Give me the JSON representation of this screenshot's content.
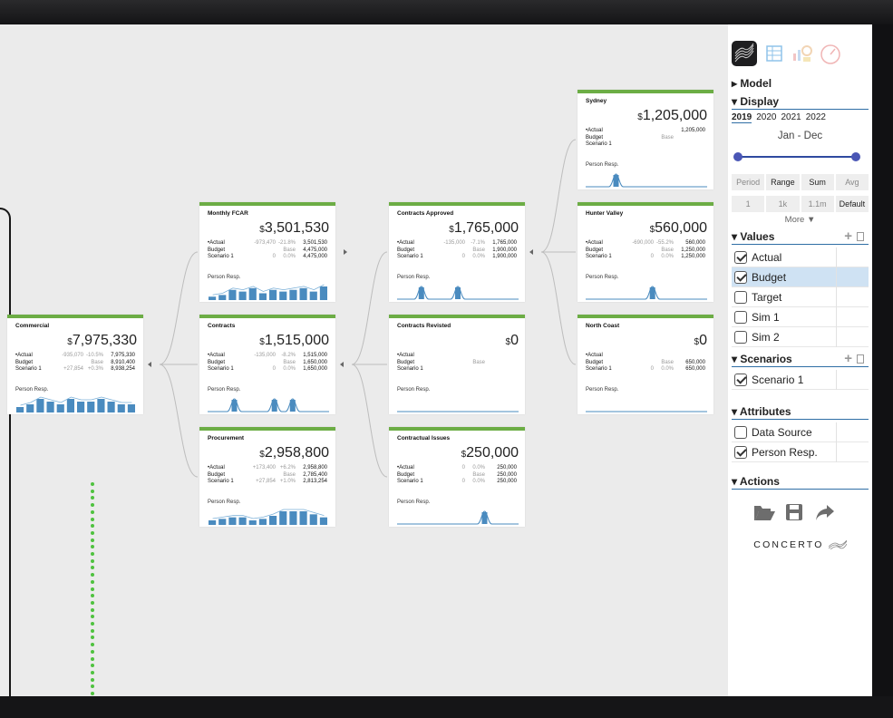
{
  "cards": [
    {
      "id": "commercial",
      "title": "Commercial",
      "total": "7,975,330",
      "currency": "$",
      "rows": [
        {
          "label": "•Actual",
          "delta": "-935,070",
          "pct": "-10.5%",
          "value": "7,975,330"
        },
        {
          "label": "Budget",
          "delta": "",
          "pct": "Base",
          "value": "8,910,400"
        },
        {
          "label": "Scenario 1",
          "delta": "+27,854",
          "pct": "+0.3%",
          "value": "8,938,254"
        }
      ],
      "person_resp": "Person Resp."
    },
    {
      "id": "monthly-fcar",
      "title": "Monthly FCAR",
      "total": "3,501,530",
      "currency": "$",
      "rows": [
        {
          "label": "•Actual",
          "delta": "-973,470",
          "pct": "-21.8%",
          "value": "3,501,530"
        },
        {
          "label": "Budget",
          "delta": "",
          "pct": "Base",
          "value": "4,475,000"
        },
        {
          "label": "Scenario 1",
          "delta": "0",
          "pct": "0.0%",
          "value": "4,475,000"
        }
      ],
      "person_resp": "Person Resp."
    },
    {
      "id": "contracts",
      "title": "Contracts",
      "total": "1,515,000",
      "currency": "$",
      "rows": [
        {
          "label": "•Actual",
          "delta": "-135,000",
          "pct": "-8.2%",
          "value": "1,515,000"
        },
        {
          "label": "Budget",
          "delta": "",
          "pct": "Base",
          "value": "1,650,000"
        },
        {
          "label": "Scenario 1",
          "delta": "0",
          "pct": "0.0%",
          "value": "1,650,000"
        }
      ],
      "person_resp": "Person Resp."
    },
    {
      "id": "procurement",
      "title": "Procurement",
      "total": "2,958,800",
      "currency": "$",
      "rows": [
        {
          "label": "•Actual",
          "delta": "+173,400",
          "pct": "+6.2%",
          "value": "2,958,800"
        },
        {
          "label": "Budget",
          "delta": "",
          "pct": "Base",
          "value": "2,785,400"
        },
        {
          "label": "Scenario 1",
          "delta": "+27,854",
          "pct": "+1.0%",
          "value": "2,813,254"
        }
      ],
      "person_resp": "Person Resp."
    },
    {
      "id": "contracts-approved",
      "title": "Contracts Approved",
      "total": "1,765,000",
      "currency": "$",
      "rows": [
        {
          "label": "•Actual",
          "delta": "-135,000",
          "pct": "-7.1%",
          "value": "1,765,000"
        },
        {
          "label": "Budget",
          "delta": "",
          "pct": "Base",
          "value": "1,900,000"
        },
        {
          "label": "Scenario 1",
          "delta": "0",
          "pct": "0.0%",
          "value": "1,900,000"
        }
      ],
      "person_resp": "Person Resp."
    },
    {
      "id": "contracts-revisted",
      "title": "Contracts Revisted",
      "total": "0",
      "currency": "$",
      "rows": [
        {
          "label": "•Actual",
          "delta": "",
          "pct": "",
          "value": ""
        },
        {
          "label": "Budget",
          "delta": "",
          "pct": "Base",
          "value": ""
        },
        {
          "label": "Scenario 1",
          "delta": "",
          "pct": "",
          "value": ""
        }
      ],
      "person_resp": "Person Resp."
    },
    {
      "id": "contractual-issues",
      "title": "Contractual Issues",
      "total": "250,000",
      "currency": "$",
      "rows": [
        {
          "label": "•Actual",
          "delta": "0",
          "pct": "0.0%",
          "value": "250,000"
        },
        {
          "label": "Budget",
          "delta": "",
          "pct": "Base",
          "value": "250,000"
        },
        {
          "label": "Scenario 1",
          "delta": "0",
          "pct": "0.0%",
          "value": "250,000"
        }
      ],
      "person_resp": "Person Resp."
    },
    {
      "id": "sydney",
      "title": "Sydney",
      "total": "1,205,000",
      "currency": "$",
      "rows": [
        {
          "label": "•Actual",
          "delta": "",
          "pct": "",
          "value": "1,205,000"
        },
        {
          "label": "Budget",
          "delta": "",
          "pct": "Base",
          "value": ""
        },
        {
          "label": "Scenario 1",
          "delta": "",
          "pct": "",
          "value": ""
        }
      ],
      "person_resp": "Person Resp."
    },
    {
      "id": "hunter-valley",
      "title": "Hunter Valley",
      "total": "560,000",
      "currency": "$",
      "rows": [
        {
          "label": "•Actual",
          "delta": "-690,000",
          "pct": "-55.2%",
          "value": "560,000"
        },
        {
          "label": "Budget",
          "delta": "",
          "pct": "Base",
          "value": "1,250,000"
        },
        {
          "label": "Scenario 1",
          "delta": "0",
          "pct": "0.0%",
          "value": "1,250,000"
        }
      ],
      "person_resp": "Person Resp."
    },
    {
      "id": "north-coast",
      "title": "North Coast",
      "total": "0",
      "currency": "$",
      "rows": [
        {
          "label": "•Actual",
          "delta": "",
          "pct": "",
          "value": ""
        },
        {
          "label": "Budget",
          "delta": "",
          "pct": "Base",
          "value": "650,000"
        },
        {
          "label": "Scenario 1",
          "delta": "0",
          "pct": "0.0%",
          "value": "650,000"
        }
      ],
      "person_resp": "Person Resp."
    }
  ],
  "panel": {
    "tabs": [
      "Graph",
      "Table",
      "Charts",
      "Dashboard"
    ],
    "model_label": "▸ Model",
    "display_label": "▾ Display",
    "years": [
      "2019",
      "2020",
      "2021",
      "2022"
    ],
    "selected_year": "2019",
    "period_text": "Jan - Dec",
    "mode_buttons": [
      "Period",
      "Range",
      "Sum",
      "Avg"
    ],
    "mode_active": [
      "Range",
      "Sum"
    ],
    "scale_buttons": [
      "1",
      "1k",
      "1.1m",
      "Default"
    ],
    "scale_active": [
      "Default"
    ],
    "more_label": "More ▼",
    "values_label": "▾ Values",
    "values": [
      {
        "label": "Actual",
        "checked": true
      },
      {
        "label": "Budget",
        "checked": true,
        "highlight": true
      },
      {
        "label": "Target",
        "checked": false
      },
      {
        "label": "Sim 1",
        "checked": false
      },
      {
        "label": "Sim 2",
        "checked": false
      }
    ],
    "scenarios_label": "▾ Scenarios",
    "scenarios": [
      {
        "label": "Scenario 1",
        "checked": true
      }
    ],
    "attributes_label": "▾ Attributes",
    "attributes": [
      {
        "label": "Data Source",
        "checked": false
      },
      {
        "label": "Person Resp.",
        "checked": true
      }
    ],
    "actions_label": "▾ Actions",
    "action_icons": [
      "folder-open-icon",
      "save-icon",
      "share-icon"
    ],
    "logo_text": "CONCERTO"
  },
  "colors": {
    "accent": "#6cad45",
    "link": "#2f6ea5",
    "spark": "#4a8bbf",
    "dots": "#4fc23f"
  }
}
